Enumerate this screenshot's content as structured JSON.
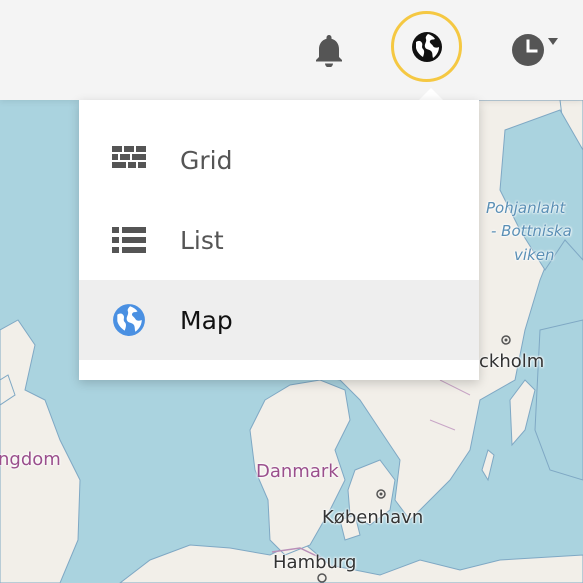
{
  "header": {
    "notifications_icon": "bell-icon",
    "view_switcher_icon": "globe-icon",
    "history_icon": "clock-icon",
    "history_dropdown_icon": "caret-down-icon",
    "focus_ring_color": "#f5c842"
  },
  "view_menu": {
    "items": [
      {
        "label": "Grid",
        "icon": "grid-icon",
        "selected": false
      },
      {
        "label": "List",
        "icon": "list-icon",
        "selected": false
      },
      {
        "label": "Map",
        "icon": "globe-icon",
        "selected": true,
        "icon_color": "#4a90e2"
      }
    ]
  },
  "map": {
    "labels": {
      "kingdom_fragment": "ngdom",
      "danmark": "Danmark",
      "kobenhavn": "København",
      "hamburg": "Hamburg",
      "stockholm_fragment": "ckholm",
      "pohjanlahti_line1": "Pohjanlaht",
      "pohjanlahti_line2": "- Bottniska",
      "pohjanlahti_line3": "viken"
    },
    "colors": {
      "water": "#aad3df",
      "land": "#f2efe9",
      "border": "#b98fb8"
    }
  }
}
